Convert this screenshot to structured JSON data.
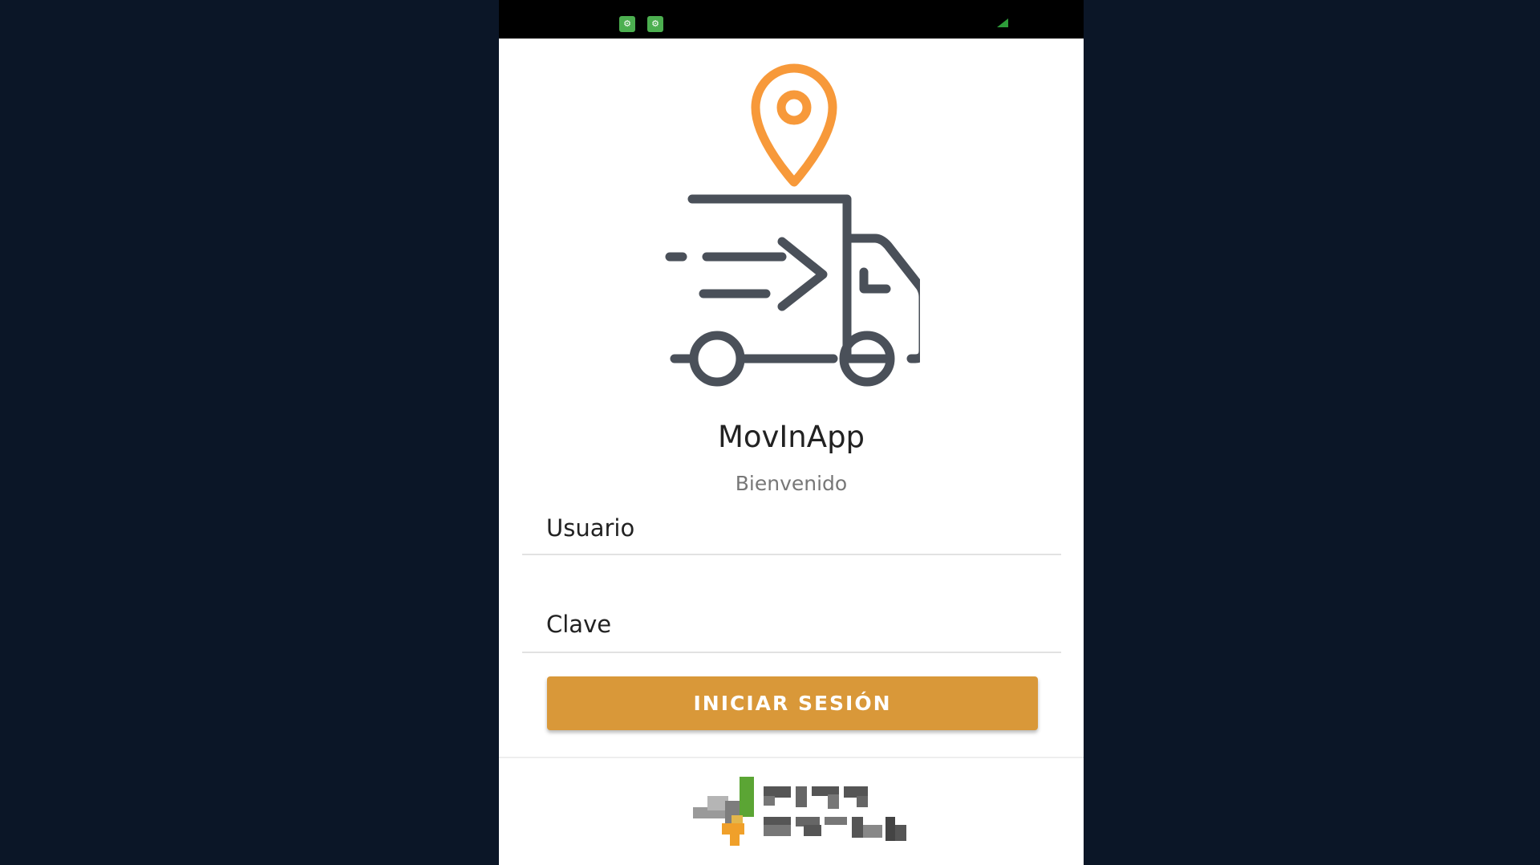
{
  "status_bar": {
    "notification_icons": [
      "android-debug-icon",
      "android-debug-icon"
    ],
    "battery_icon": "battery-icon",
    "battery_color": "#2e9d3a"
  },
  "brand": {
    "logo_icon": "delivery-truck-location-icon",
    "title": "MovInApp",
    "subtitle": "Bienvenido",
    "accent_color": "#f7993a",
    "icon_color": "#4a5059"
  },
  "form": {
    "username_placeholder": "Usuario",
    "password_placeholder": "Clave",
    "login_label": "INICIAR SESIÓN",
    "button_color": "#d99839"
  },
  "footer": {
    "logo_icon": "company-logo",
    "logo_text": ""
  }
}
